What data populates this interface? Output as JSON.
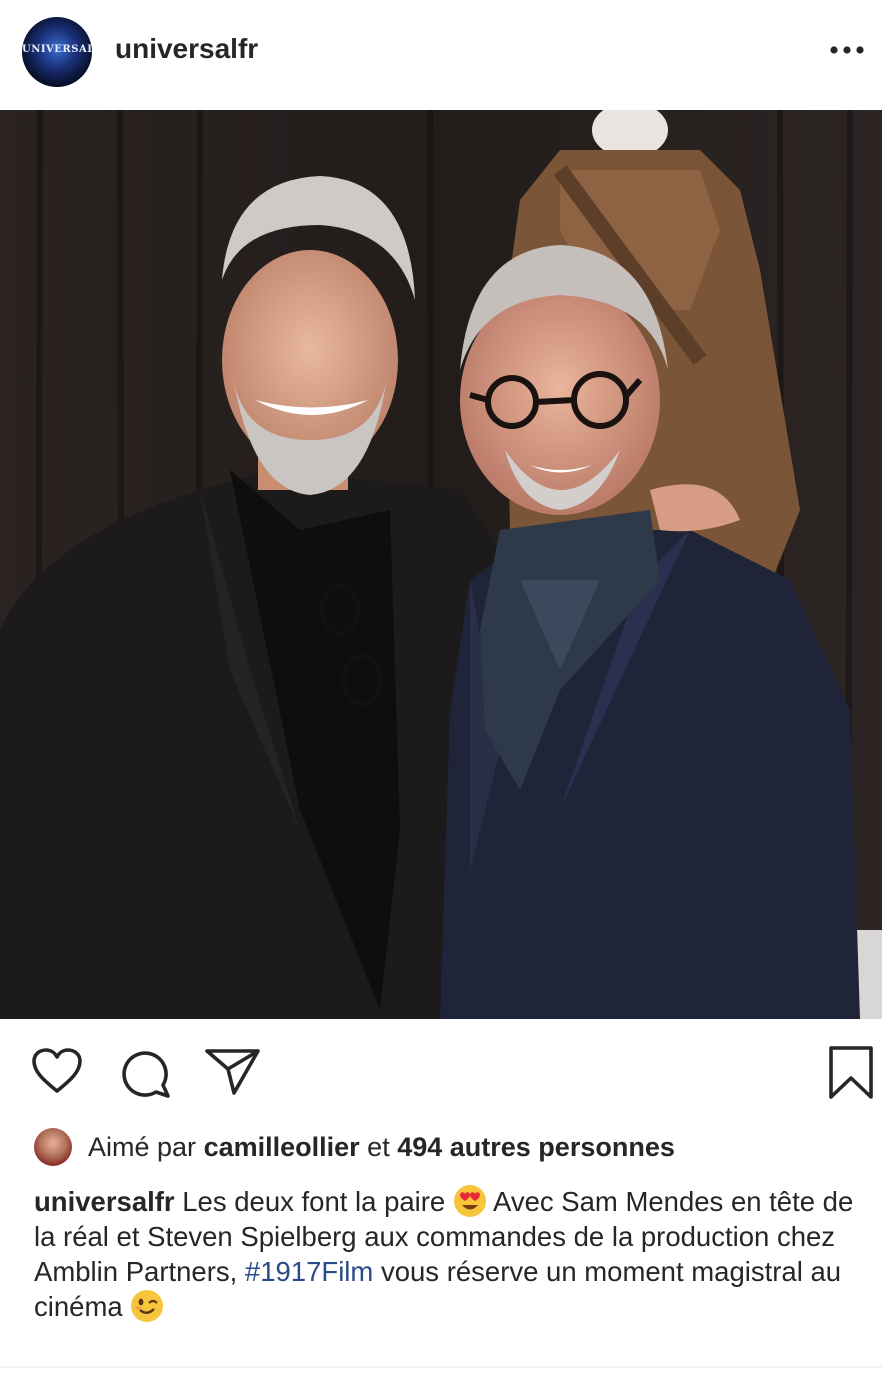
{
  "post": {
    "username": "universalfr",
    "avatar_text": "UNIVERSAL",
    "more_icon": "more-horizontal-icon"
  },
  "actions": {
    "like_icon": "heart-icon",
    "comment_icon": "comment-icon",
    "share_icon": "paper-plane-icon",
    "save_icon": "bookmark-icon"
  },
  "likes": {
    "prefix": "Aimé par",
    "liker": "camilleollier",
    "connector": "et",
    "others": "494 autres personnes"
  },
  "caption": {
    "username": "universalfr",
    "text_1": "Les deux font la paire",
    "emoji_1": "heart-eyes-emoji",
    "text_2": "Avec Sam Mendes en tête de la réal et Steven Spielberg aux commandes de la production chez Amblin Partners,",
    "hashtag": "#1917Film",
    "text_3": "vous réserve un moment magistral au cinéma",
    "emoji_2": "winking-face-emoji"
  },
  "colors": {
    "text": "#262626",
    "hashtag": "#2b4a8a",
    "background": "#ffffff"
  }
}
